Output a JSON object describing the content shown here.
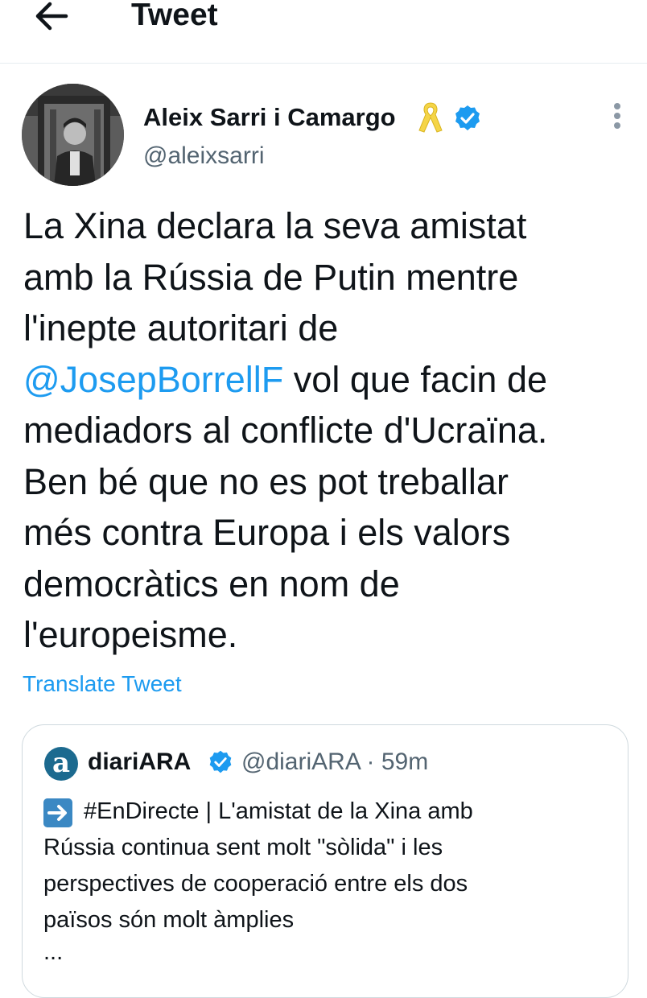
{
  "header": {
    "back_icon": "arrow-left-icon",
    "title": "Tweet"
  },
  "tweet": {
    "author_name": "Aleix Sarri i Camargo",
    "author_handle": "@aleixsarri",
    "ribbon_icon": "yellow-ribbon-icon",
    "verified_icon": "verified-badge-icon",
    "more_icon": "more-vertical-icon",
    "text_part1": "La Xina declara la seva amistat\namb la Rússia de Putin mentre\nl'inepte autoritari de\n",
    "mention": "@JosepBorrellF",
    "text_part2": " vol que facin de\nmediadors al conflicte d'Ucraïna.\nBen bé que no es pot treballar\nmés contra Europa i els valors\ndemocràtics en nom de\nl'europeisme.",
    "translate_label": "Translate Tweet"
  },
  "quoted_tweet": {
    "avatar_letter": "a",
    "author_name": "diariARA",
    "author_handle": "@diariARA",
    "separator": "·",
    "time": "59m",
    "meta": "@diariARA · 59m",
    "arrow_icon": "right-arrow-emoji-icon",
    "text": "#EnDirecte | L'amistat de la Xina amb\nRússia continua sent molt \"sòlida\" i les\nperspectives de cooperació entre els dos\npaïsos són molt àmplies",
    "ellipsis": "..."
  },
  "colors": {
    "link": "#1d9bf0",
    "secondary_text": "#536471",
    "primary_text": "#0f1419",
    "border": "#cfd9de",
    "verified": "#1d9bf0",
    "ribbon": "#f5d547"
  }
}
